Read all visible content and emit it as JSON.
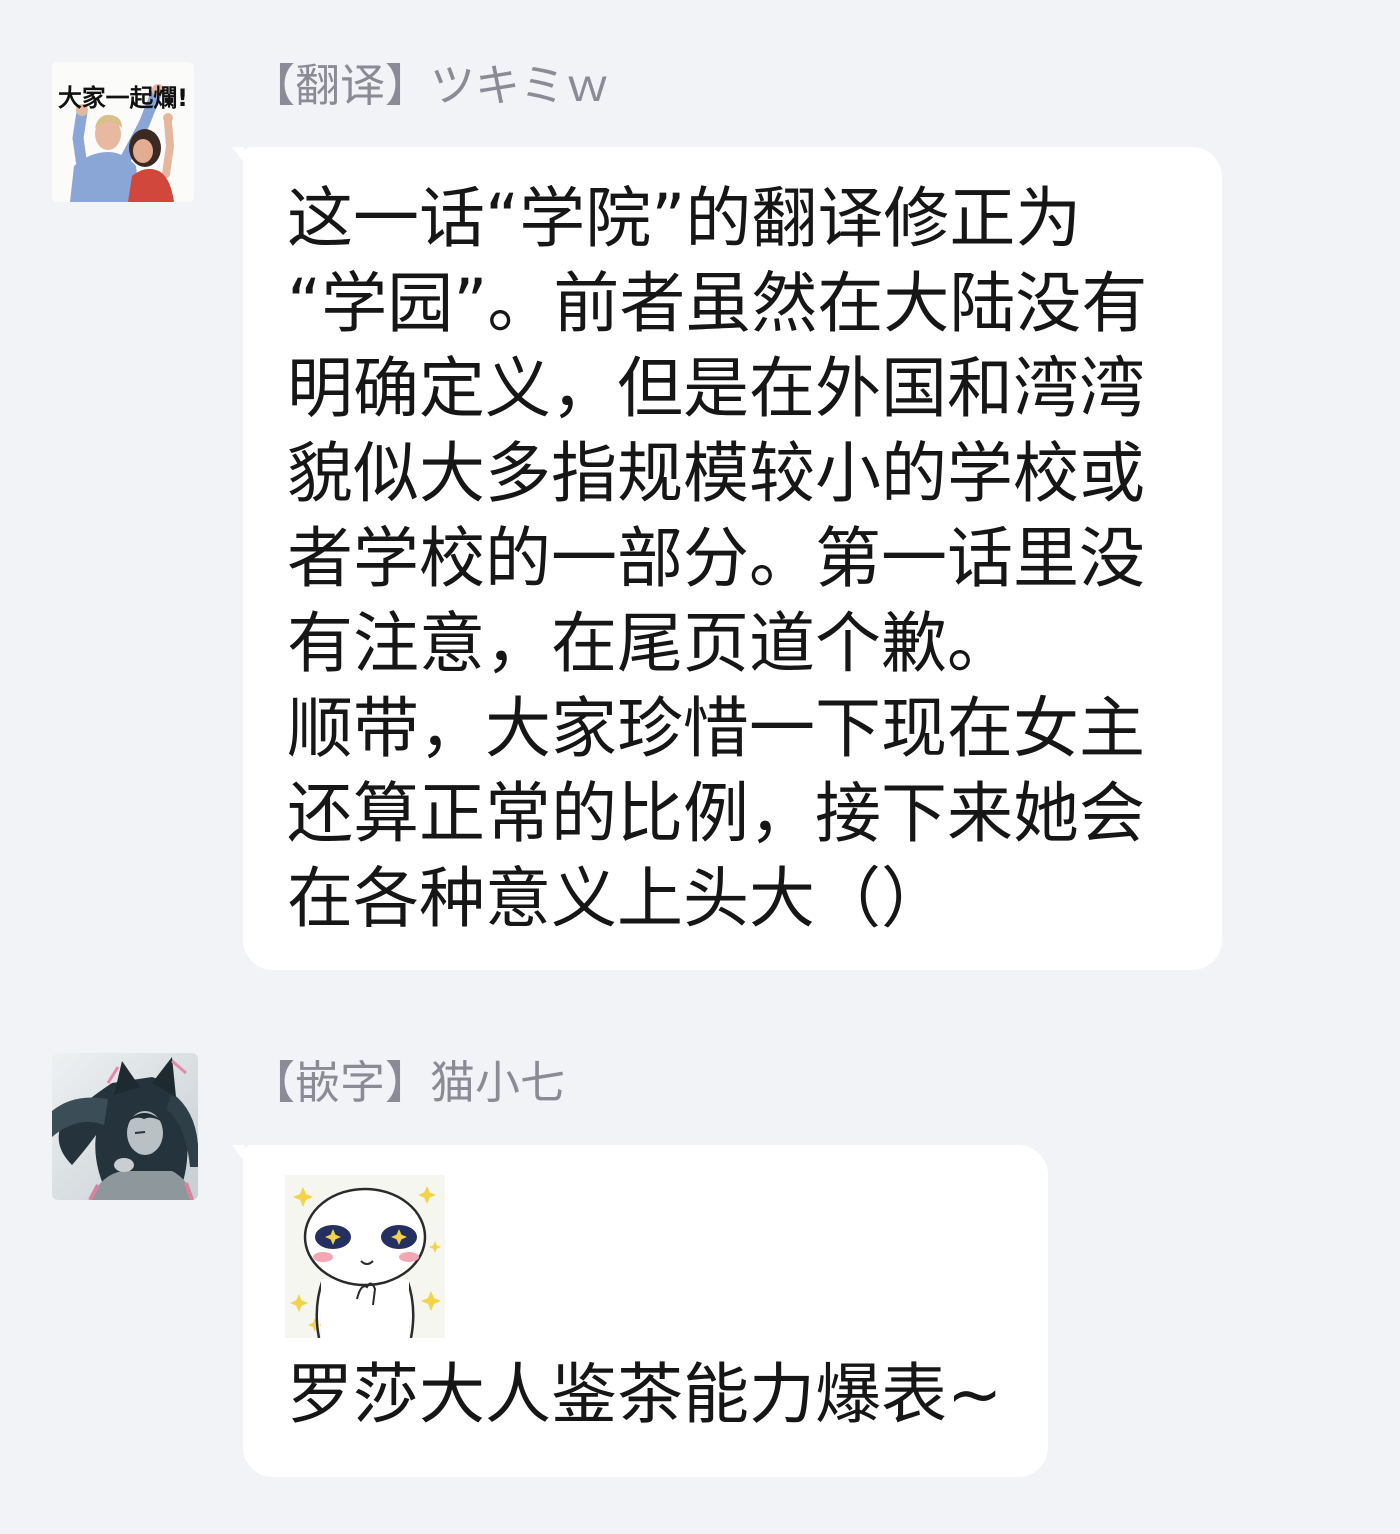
{
  "theme": {
    "background": "#f2f3f7",
    "bubble_color": "#ffffff",
    "sender_name_color": "#8a8b96",
    "message_text_color": "#161616"
  },
  "messages": [
    {
      "sender": "【翻译】ツキミｗ",
      "avatar": {
        "caption": "大家一起爛!"
      },
      "lines": [
        "这一话“学院”的翻译修正为",
        "“学园”。前者虽然在大陆没有",
        "明确定义，但是在外国和湾湾",
        "貌似大多指规模较小的学校或",
        "者学校的一部分。第一话里没",
        "有注意，在尾页道个歉。",
        "顺带，大家珍惜一下现在女主",
        "还算正常的比例，接下来她会",
        "在各种意义上头大（）"
      ]
    },
    {
      "sender": "【嵌字】猫小七",
      "sticker": {
        "icon": "star-eyes-sticker"
      },
      "lines": [
        "罗莎大人鉴茶能力爆表~"
      ]
    }
  ]
}
